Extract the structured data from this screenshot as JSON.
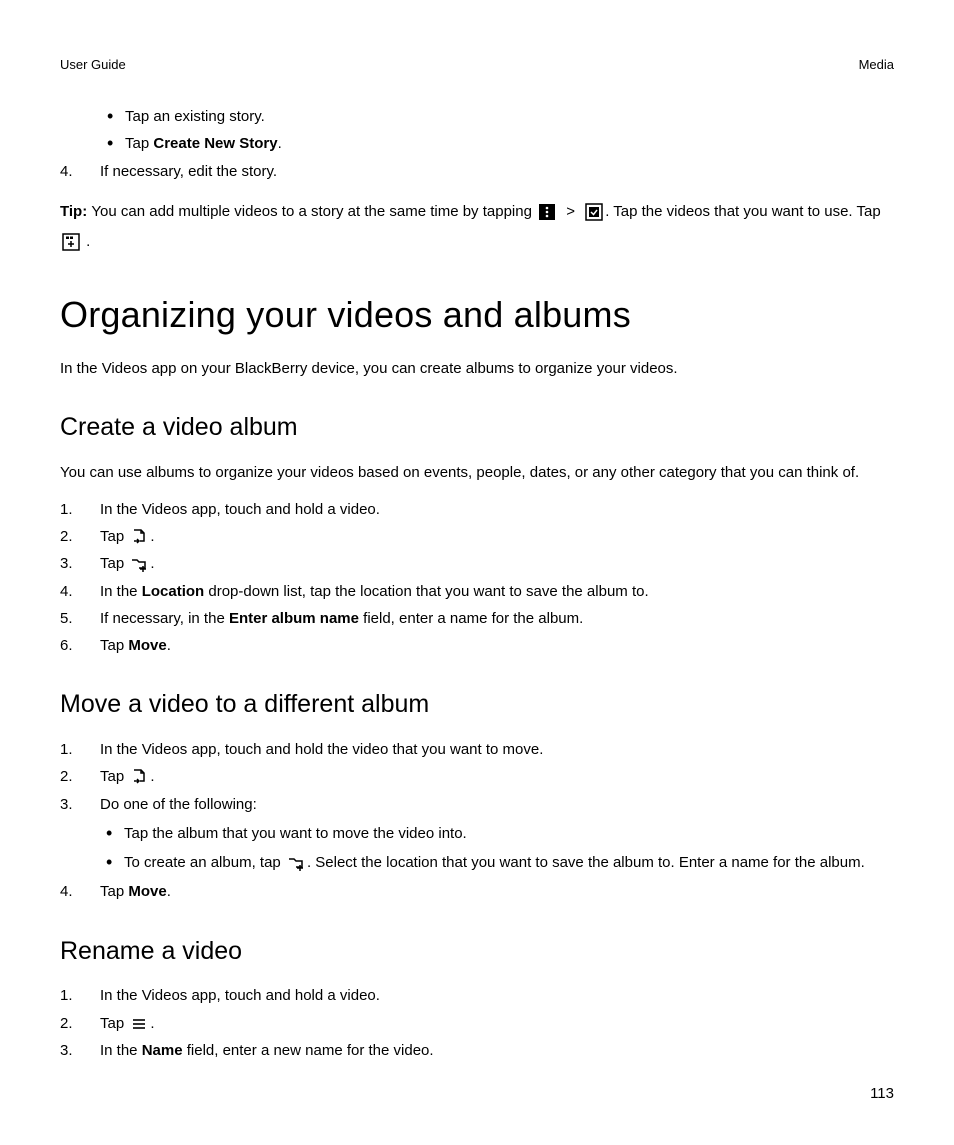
{
  "header": {
    "left": "User Guide",
    "right": "Media"
  },
  "topBullets": {
    "b1": "Tap an existing story.",
    "b2_pre": "Tap ",
    "b2_bold": "Create New Story",
    "b2_post": "."
  },
  "step4": {
    "num": "4.",
    "text": "If necessary, edit the story."
  },
  "tip": {
    "label": "Tip: ",
    "part1": "You can add multiple videos to a story at the same time by tapping ",
    "gt": ">",
    "part2": ". Tap the videos that you want to use. Tap ",
    "end": "."
  },
  "h1": "Organizing your videos and albums",
  "intro": "In the Videos app on your BlackBerry device, you can create albums to organize your videos.",
  "secA": {
    "title": "Create a video album",
    "para": "You can use albums to organize your videos based on events, people, dates, or any other category that you can think of.",
    "s1": {
      "num": "1.",
      "text": "In the Videos app, touch and hold a video."
    },
    "s2": {
      "num": "2.",
      "pre": "Tap ",
      "post": "."
    },
    "s3": {
      "num": "3.",
      "pre": "Tap ",
      "post": "."
    },
    "s4": {
      "num": "4.",
      "pre": "In the ",
      "bold": "Location",
      "post": " drop-down list, tap the location that you want to save the album to."
    },
    "s5": {
      "num": "5.",
      "pre": "If necessary, in the ",
      "bold": "Enter album name",
      "post": " field, enter a name for the album."
    },
    "s6": {
      "num": "6.",
      "pre": "Tap ",
      "bold": "Move",
      "post": "."
    }
  },
  "secB": {
    "title": "Move a video to a different album",
    "s1": {
      "num": "1.",
      "text": "In the Videos app, touch and hold the video that you want to move."
    },
    "s2": {
      "num": "2.",
      "pre": "Tap ",
      "post": "."
    },
    "s3": {
      "num": "3.",
      "text": "Do one of the following:",
      "b1": "Tap the album that you want to move the video into.",
      "b2_pre": "To create an album, tap ",
      "b2_post": ". Select the location that you want to save the album to. Enter a name for the album."
    },
    "s4": {
      "num": "4.",
      "pre": "Tap ",
      "bold": "Move",
      "post": "."
    }
  },
  "secC": {
    "title": "Rename a video",
    "s1": {
      "num": "1.",
      "text": "In the Videos app, touch and hold a video."
    },
    "s2": {
      "num": "2.",
      "pre": "Tap ",
      "post": "."
    },
    "s3": {
      "num": "3.",
      "pre": "In the ",
      "bold": "Name",
      "post": " field, enter a new name for the video."
    }
  },
  "pageNum": "113"
}
